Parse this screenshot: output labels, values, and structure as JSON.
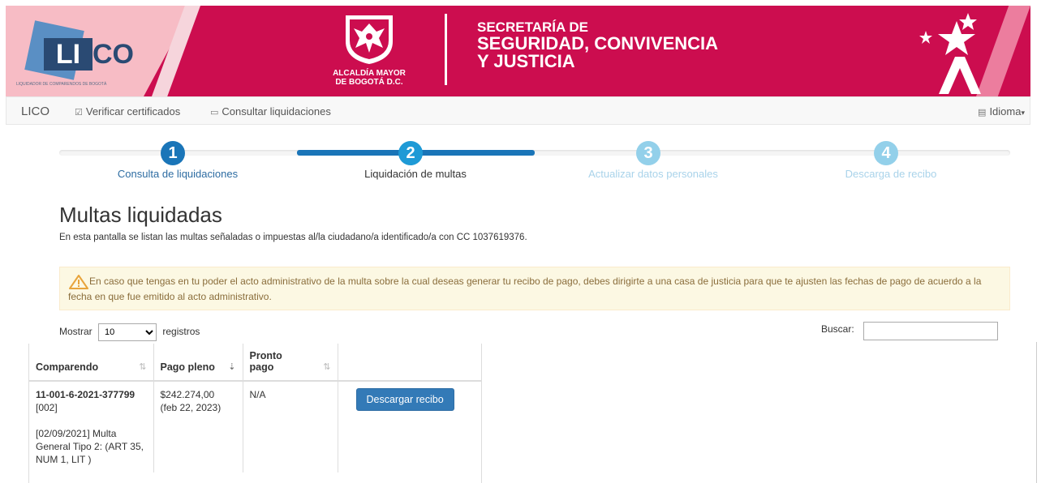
{
  "banner": {
    "logo_text_li": "LI",
    "logo_text_co": "CO",
    "logo_tagline": "LIQUIDADOR DE COMPARENDOS DE BOGOTÁ",
    "alcaldia_line1": "ALCALDÍA MAYOR",
    "alcaldia_line2": "DE BOGOTÁ D.C.",
    "secretaria_line1": "SECRETARÍA DE",
    "secretaria_line2": "SEGURIDAD, CONVIVENCIA",
    "secretaria_line3": "Y JUSTICIA"
  },
  "navbar": {
    "brand": "LICO",
    "verify": "Verificar certificados",
    "consult": "Consultar liquidaciones",
    "language": "Idioma"
  },
  "wizard": {
    "steps": [
      {
        "num": "1",
        "label": "Consulta de liquidaciones",
        "state": "done"
      },
      {
        "num": "2",
        "label": "Liquidación de multas",
        "state": "active"
      },
      {
        "num": "3",
        "label": "Actualizar datos personales",
        "state": "pending"
      },
      {
        "num": "4",
        "label": "Descarga de recibo",
        "state": "pending"
      }
    ],
    "colors": {
      "done": "#1a75b8",
      "active": "#1e9ad6",
      "pending": "#93d0ea",
      "pending_text": "#a9d3ea",
      "done_text": "#2d6ca2"
    }
  },
  "page": {
    "title": "Multas liquidadas",
    "subtitle": "En esta pantalla se listan las multas señaladas o impuestas al/la ciudadano/a identificado/a con CC 1037619376."
  },
  "alert": {
    "text": "En caso que tengas en tu poder el acto administrativo de la multa sobre la cual deseas generar tu recibo de pago, debes dirigirte a una casa de justicia para que te ajusten las fechas de pago de acuerdo a la fecha en que fue emitido al acto administrativo."
  },
  "table_controls": {
    "show_label": "Mostrar",
    "show_value": "10",
    "records_label": "registros",
    "search_label": "Buscar:"
  },
  "table": {
    "headers": [
      "Comparendo",
      "Pago pleno",
      "Pronto pago",
      ""
    ],
    "rows": [
      {
        "comparendo_id": "11-001-6-2021-377799",
        "comparendo_code": "[002]",
        "comparendo_desc": "[02/09/2021] Multa General Tipo 2: (ART 35, NUM 1, LIT )",
        "pago_pleno": "$242.274,00",
        "pago_pleno_date": "(feb 22, 2023)",
        "pronto_pago": "N/A",
        "action": "Descargar recibo"
      }
    ]
  },
  "colors": {
    "banner": "#cc0d4f",
    "primary_button": "#337ab7",
    "alert_bg": "#fcf8e3",
    "alert_text": "#8a6d3b"
  }
}
